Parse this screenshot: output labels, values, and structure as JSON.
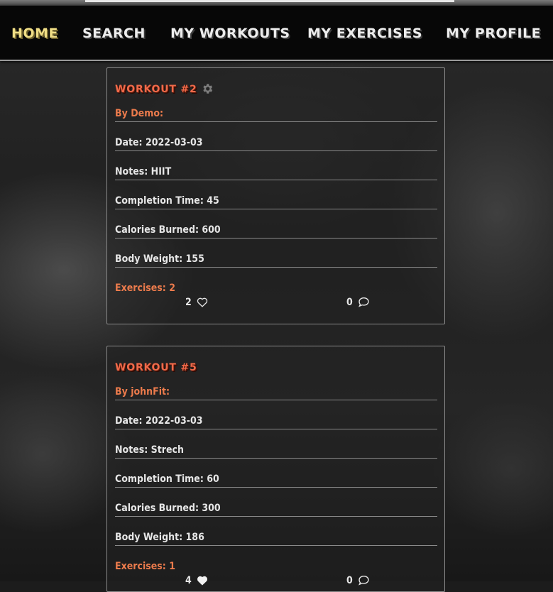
{
  "nav": {
    "items": [
      {
        "label": "Home",
        "active": true
      },
      {
        "label": "Search"
      },
      {
        "label": "My Workouts"
      },
      {
        "label": "My Exercises"
      },
      {
        "label": "My Profile"
      }
    ]
  },
  "workouts": [
    {
      "title": "Workout #2",
      "has_settings_icon": true,
      "by": "By Demo:",
      "date": "Date: 2022-03-03",
      "notes": "Notes: HIIT",
      "completion_time": "Completion Time: 45",
      "calories": "Calories Burned: 600",
      "body_weight": "Body Weight: 155",
      "exercises": "Exercises: 2",
      "likes": "2",
      "liked": false,
      "comments": "0"
    },
    {
      "title": "Workout #5",
      "has_settings_icon": false,
      "by": "By johnFit:",
      "date": "Date: 2022-03-03",
      "notes": "Notes: Strech",
      "completion_time": "Completion Time: 60",
      "calories": "Calories Burned: 300",
      "body_weight": "Body Weight: 186",
      "exercises": "Exercises: 1",
      "likes": "4",
      "liked": true,
      "comments": "0"
    }
  ],
  "icons": {
    "settings": "gear-icon",
    "like_empty": "heart-outline-icon",
    "like_filled": "heart-filled-icon",
    "comment": "comment-bubble-icon"
  },
  "colors": {
    "nav_active": "#f0de86",
    "nav_text": "#ececec",
    "accent_orange": "#ec7b4c",
    "title_red": "#f06a4a"
  }
}
